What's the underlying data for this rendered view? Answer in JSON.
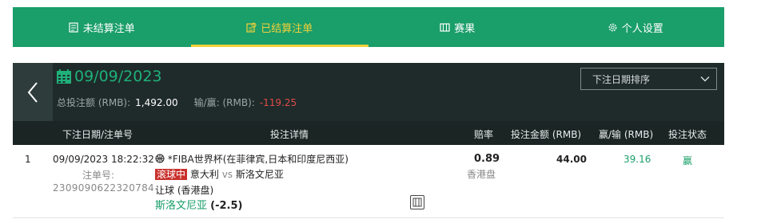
{
  "nav": {
    "tabs": [
      {
        "label": "未结算注单",
        "icon": "ticket-icon"
      },
      {
        "label": "已结算注单",
        "icon": "settled-ticket-icon"
      },
      {
        "label": "赛果",
        "icon": "results-icon"
      },
      {
        "label": "个人设置",
        "icon": "gear-icon"
      }
    ],
    "active_index": 1
  },
  "header": {
    "date": "09/09/2023",
    "total_label": "总投注额 (RMB):",
    "total_value": "1,492.00",
    "winloss_label": "输/赢: (RMB):",
    "winloss_value": "-119.25",
    "sort_selected": "下注日期排序"
  },
  "table": {
    "columns": [
      "下注日期/注单号",
      "投注详情",
      "赔率",
      "投注金额 (RMB)",
      "赢/输 (RMB)",
      "投注状态"
    ],
    "rows": [
      {
        "index": "1",
        "datetime": "09/09/2023 18:22:32",
        "order_label": "注单号:",
        "order_no": "2309090622320784",
        "competition": "*FIBA世界杯(在菲律宾,日本和印度尼西亚)",
        "live_tag": "滚球中",
        "home": "意大利",
        "vs": "vs",
        "away": "斯洛文尼亚",
        "market": "让球 (香港盘)",
        "selection": "斯洛文尼亚",
        "handicap": "(-2.5)",
        "odds": "0.89",
        "odds_type": "香港盘",
        "stake": "44.00",
        "winloss": "39.16",
        "status": "赢"
      }
    ]
  },
  "colors": {
    "brand_green": "#1a9e6a",
    "active_yellow": "#f4d13a",
    "header_dark": "#1f2b2a",
    "negative_red": "#e04a4a",
    "live_red": "#c9302c"
  }
}
